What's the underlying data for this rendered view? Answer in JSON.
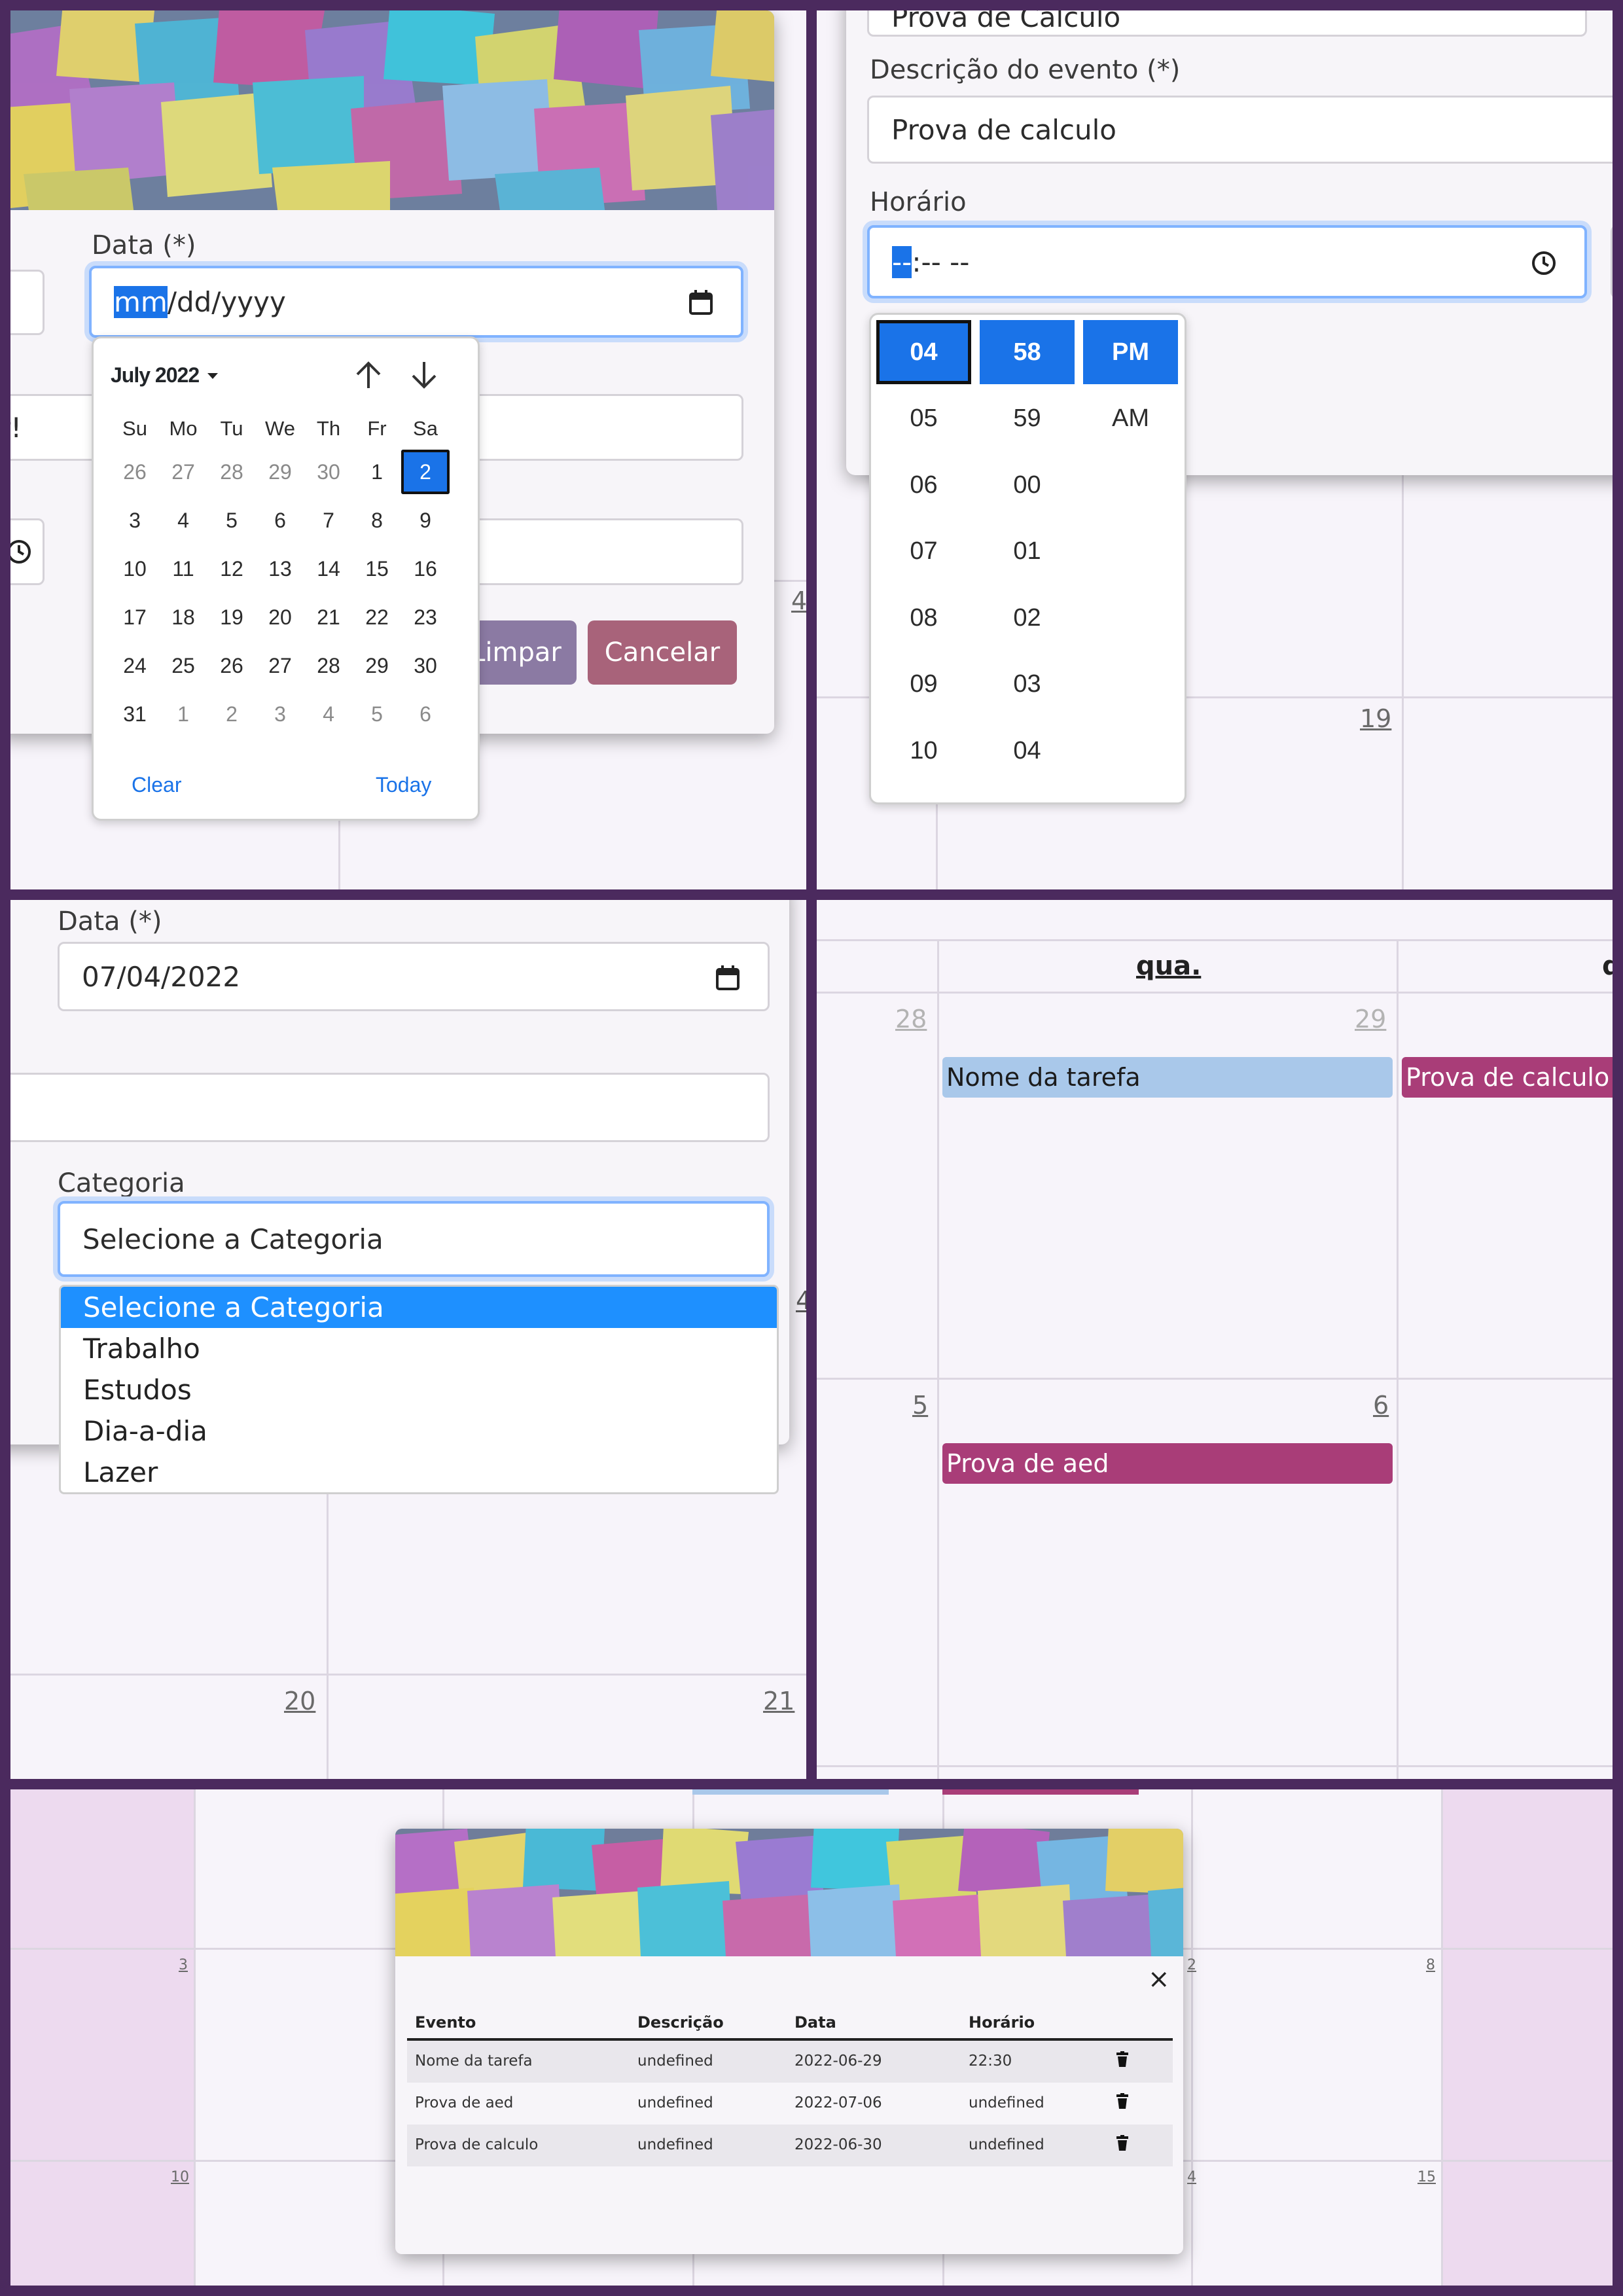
{
  "date_panel": {
    "date_label": "Data (*)",
    "date_seg_mm": "mm",
    "date_rest": "/dd/yyyy",
    "partial_text": "r!",
    "limpar": "Limpar",
    "cancelar": "Cancelar",
    "right_digit": "4"
  },
  "datepicker": {
    "month_label": "July 2022",
    "weekdays": [
      "Su",
      "Mo",
      "Tu",
      "We",
      "Th",
      "Fr",
      "Sa"
    ],
    "weeks": [
      [
        "26",
        "27",
        "28",
        "29",
        "30",
        "1",
        "2"
      ],
      [
        "3",
        "4",
        "5",
        "6",
        "7",
        "8",
        "9"
      ],
      [
        "10",
        "11",
        "12",
        "13",
        "14",
        "15",
        "16"
      ],
      [
        "17",
        "18",
        "19",
        "20",
        "21",
        "22",
        "23"
      ],
      [
        "24",
        "25",
        "26",
        "27",
        "28",
        "29",
        "30"
      ],
      [
        "31",
        "1",
        "2",
        "3",
        "4",
        "5",
        "6"
      ]
    ],
    "selected": "2",
    "clear": "Clear",
    "today": "Today"
  },
  "time_panel": {
    "title_value": "Prova de Calculo",
    "desc_label": "Descrição do evento (*)",
    "desc_value": "Prova de calculo",
    "time_label": "Horário",
    "time_seg": "--",
    "time_rest": ":-- --",
    "cal_day": "19",
    "right_char": "("
  },
  "timepicker": {
    "hours": [
      "04",
      "05",
      "06",
      "07",
      "08",
      "09",
      "10"
    ],
    "minutes": [
      "58",
      "59",
      "00",
      "01",
      "02",
      "03",
      "04"
    ],
    "ampm": [
      "PM",
      "AM"
    ]
  },
  "category_panel": {
    "date_label": "Data (*)",
    "date_value": "07/04/2022",
    "cat_label": "Categoria",
    "cat_value": "Selecione a Categoria",
    "options": [
      "Selecione a Categoria",
      "Trabalho",
      "Estudos",
      "Dia-a-dia",
      "Lazer"
    ],
    "day_20": "20",
    "day_21": "21",
    "right_digit": "4"
  },
  "calendar_panel": {
    "header": "qua.",
    "header_partial": "q",
    "days": {
      "d28": "28",
      "d29": "29",
      "d5": "5",
      "d6": "6"
    },
    "events": {
      "ev1": "Nome da tarefa",
      "ev2": "Prova de calculo",
      "ev3": "Prova de aed"
    },
    "colors": {
      "blue_event": "#a9c8ea",
      "pink_event": "#a93d78"
    }
  },
  "list_panel": {
    "days": {
      "d3": "3",
      "d8": "8",
      "d10": "10",
      "d15": "15",
      "p2": "2",
      "p4": "4"
    },
    "close": "×",
    "headers": [
      "Evento",
      "Descrição",
      "Data",
      "Horário"
    ],
    "rows": [
      {
        "evento": "Nome da tarefa",
        "descricao": "undefined",
        "data": "2022-06-29",
        "horario": "22:30"
      },
      {
        "evento": "Prova de aed",
        "descricao": "undefined",
        "data": "2022-07-06",
        "horario": "undefined"
      },
      {
        "evento": "Prova de calculo",
        "descricao": "undefined",
        "data": "2022-06-30",
        "horario": "undefined"
      }
    ]
  },
  "colors": {
    "frame": "#4b2a5e",
    "accent": "#1a73e8",
    "limpar": "#8b7aa3",
    "cancelar": "#a8637a"
  }
}
